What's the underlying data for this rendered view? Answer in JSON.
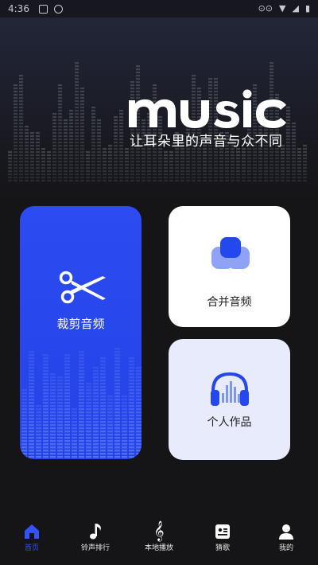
{
  "status_bar": {
    "time": "4:36"
  },
  "header": {
    "logo_text": "music",
    "slogan": "让耳朵里的声音与众不同"
  },
  "cards": {
    "cut": {
      "label": "裁剪音频",
      "icon": "scissors-icon"
    },
    "merge": {
      "label": "合并音频",
      "icon": "merge-icon"
    },
    "works": {
      "label": "个人作品",
      "icon": "headphones-icon"
    }
  },
  "tabs": [
    {
      "label": "首页",
      "icon": "home-icon",
      "active": true
    },
    {
      "label": "铃声排行",
      "icon": "music-note-icon",
      "active": false
    },
    {
      "label": "本地播放",
      "icon": "treble-clef-icon",
      "active": false
    },
    {
      "label": "猜歌",
      "icon": "guess-card-icon",
      "active": false
    },
    {
      "label": "我的",
      "icon": "user-icon",
      "active": false
    }
  ],
  "colors": {
    "accent": "#3352ff",
    "card_blue": "#2c4cf2",
    "background": "#151518"
  }
}
